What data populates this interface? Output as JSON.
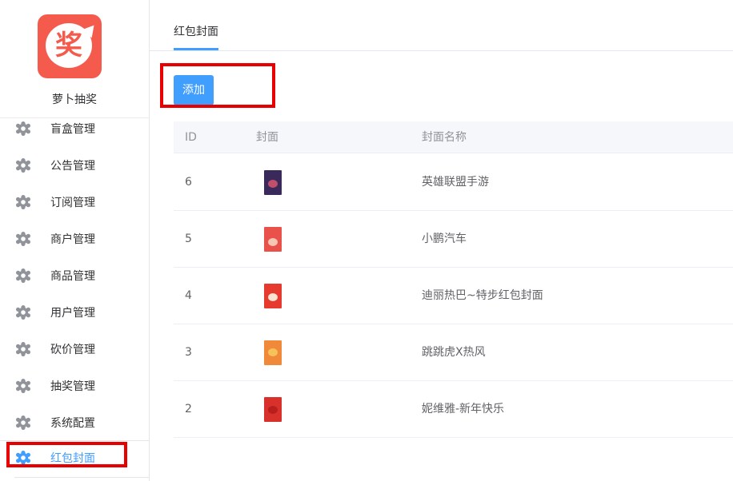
{
  "sidebar": {
    "logo_glyph": "奖",
    "app_name": "萝卜抽奖",
    "items": [
      {
        "label": "盲盒管理",
        "active": false
      },
      {
        "label": "公告管理",
        "active": false
      },
      {
        "label": "订阅管理",
        "active": false
      },
      {
        "label": "商户管理",
        "active": false
      },
      {
        "label": "商品管理",
        "active": false
      },
      {
        "label": "用户管理",
        "active": false
      },
      {
        "label": "砍价管理",
        "active": false
      },
      {
        "label": "抽奖管理",
        "active": false
      },
      {
        "label": "系统配置",
        "active": false
      },
      {
        "label": "红包封面",
        "active": true
      }
    ]
  },
  "tabs": [
    {
      "label": "红包封面",
      "active": true
    }
  ],
  "toolbar": {
    "add_label": "添加"
  },
  "table": {
    "columns": [
      "ID",
      "封面",
      "封面名称"
    ],
    "rows": [
      {
        "id": "6",
        "name": "英雄联盟手游",
        "cover_icon": "cover-thumbnail",
        "cover_color": "#3a2a5c"
      },
      {
        "id": "5",
        "name": "小鹏汽车",
        "cover_icon": "cover-thumbnail",
        "cover_color": "#e8524a"
      },
      {
        "id": "4",
        "name": "迪丽热巴~特步红包封面",
        "cover_icon": "cover-thumbnail",
        "cover_color": "#e63a2e"
      },
      {
        "id": "3",
        "name": "跳跳虎X热风",
        "cover_icon": "cover-thumbnail",
        "cover_color": "#f08a3a"
      },
      {
        "id": "2",
        "name": "妮维雅-新年快乐",
        "cover_icon": "cover-thumbnail",
        "cover_color": "#d8302a"
      }
    ]
  },
  "colors": {
    "accent": "#409eff",
    "annotation": "#e80000",
    "brand": "#f45b4c"
  }
}
